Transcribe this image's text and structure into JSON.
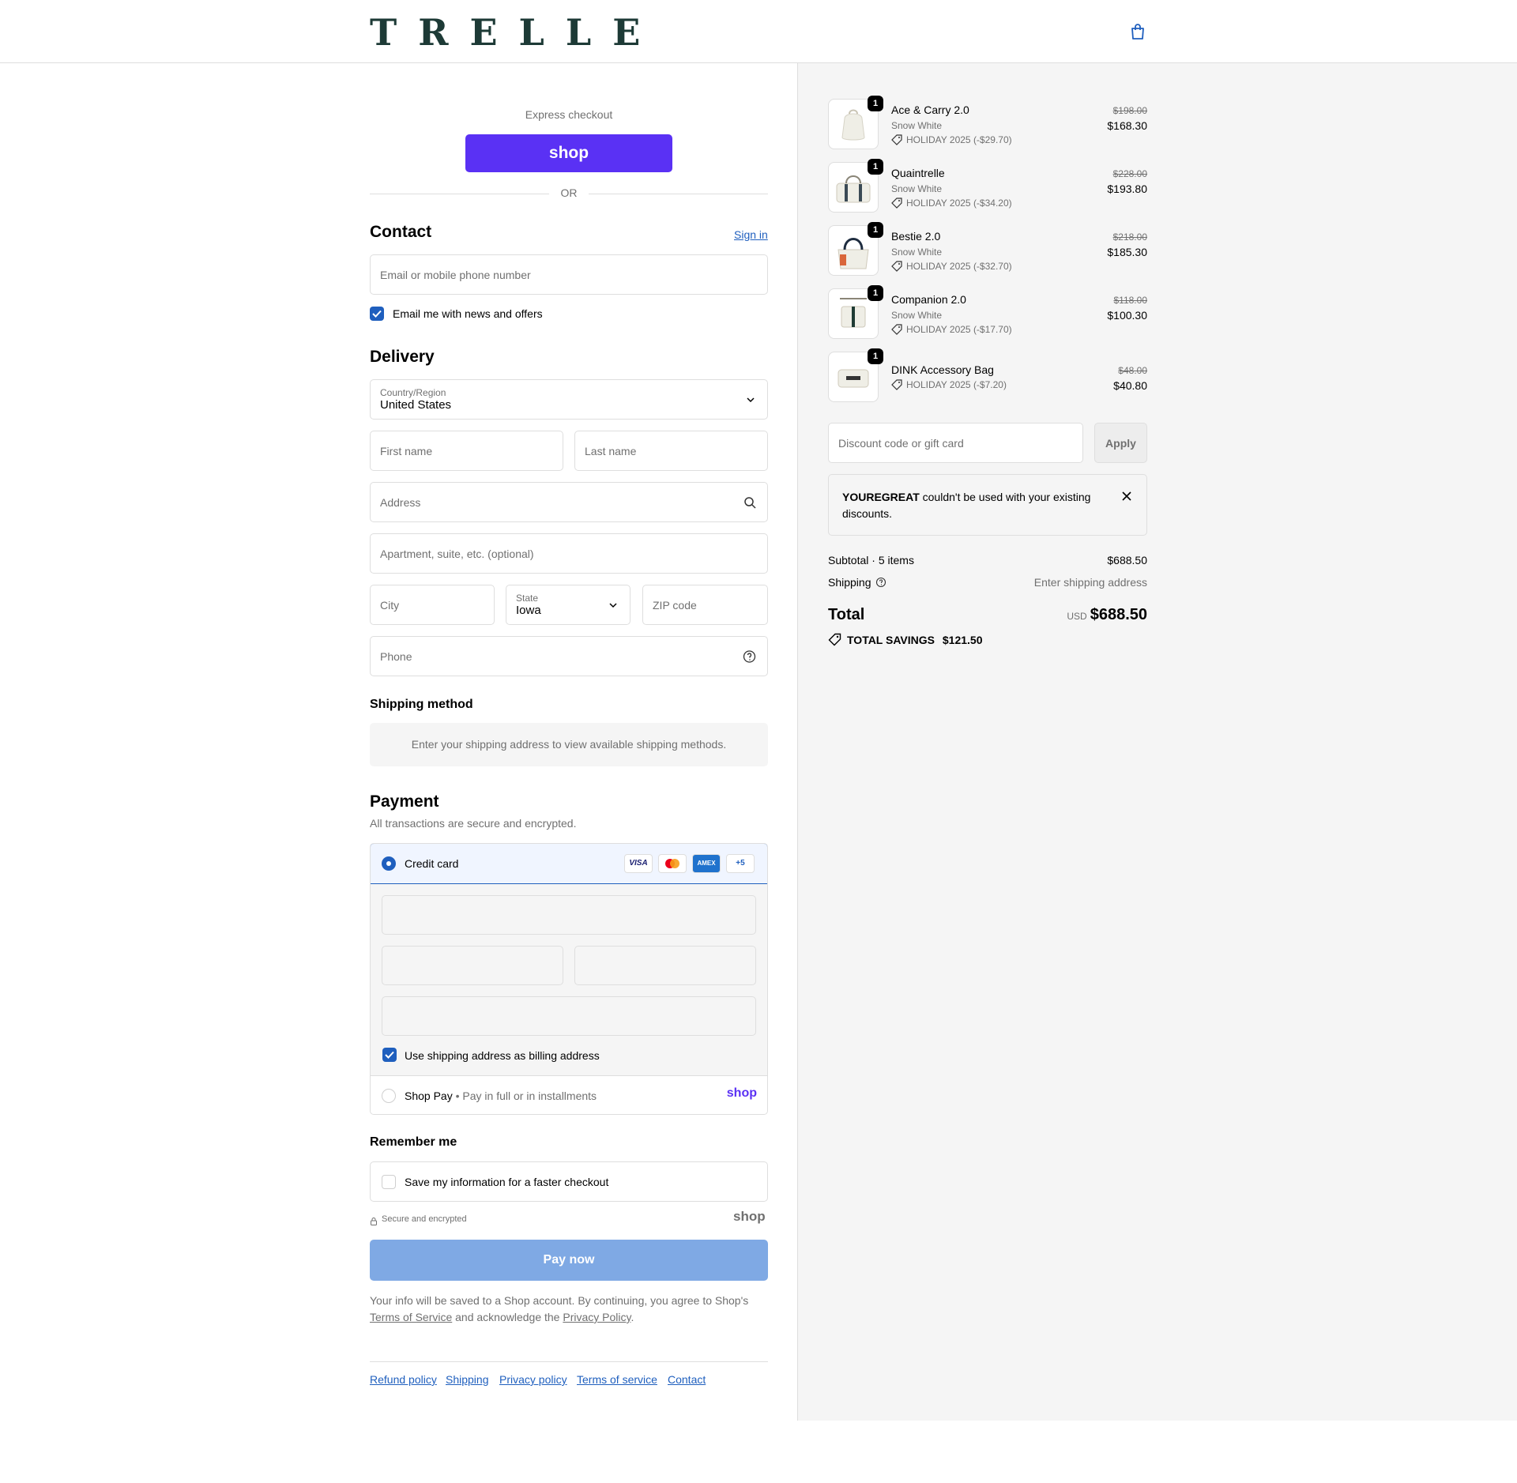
{
  "header": {
    "logo": "TRELLE",
    "cart_icon": "shopping-bag-icon"
  },
  "express": {
    "label": "Express checkout",
    "shop_button": "shop",
    "divider": "OR"
  },
  "contact": {
    "heading": "Contact",
    "sign_in": "Sign in",
    "email_placeholder": "Email or mobile phone number",
    "news_label": "Email me with news and offers",
    "news_checked": true
  },
  "delivery": {
    "heading": "Delivery",
    "country_label": "Country/Region",
    "country_value": "United States",
    "first_name": "First name",
    "last_name": "Last name",
    "address": "Address",
    "apartment": "Apartment, suite, etc. (optional)",
    "city": "City",
    "state_label": "State",
    "state_value": "Iowa",
    "zip": "ZIP code",
    "phone": "Phone"
  },
  "shipping_method": {
    "heading": "Shipping method",
    "message": "Enter your shipping address to view available shipping methods."
  },
  "payment": {
    "heading": "Payment",
    "subtitle": "All transactions are secure and encrypted.",
    "credit_card_label": "Credit card",
    "card_logos": [
      "VISA",
      "",
      "AMEX",
      "+5"
    ],
    "billing_label": "Use shipping address as billing address",
    "shop_pay_label": "Shop Pay",
    "shop_pay_sub": "Pay in full or in installments",
    "shop_pay_logo": "shop"
  },
  "remember": {
    "heading": "Remember me",
    "save_label": "Save my information for a faster checkout",
    "secure_label": "Secure and encrypted",
    "shop_logo": "shop"
  },
  "pay_button": "Pay now",
  "legal": {
    "text1": "Your info will be saved to a Shop account. By continuing, you agree to Shop's",
    "tos": "Terms of Service",
    "text2": "and acknowledge the",
    "privacy": "Privacy Policy",
    "text3": "."
  },
  "footer_links": [
    "Refund policy",
    "Shipping",
    "Privacy policy",
    "Terms of service",
    "Contact"
  ],
  "cart": {
    "items": [
      {
        "name": "Ace & Carry 2.0",
        "variant": "Snow White",
        "discount": "HOLIDAY 2025 (-$29.70)",
        "old_price": "$198.00",
        "price": "$168.30",
        "qty": "1"
      },
      {
        "name": "Quaintrelle",
        "variant": "Snow White",
        "discount": "HOLIDAY 2025 (-$34.20)",
        "old_price": "$228.00",
        "price": "$193.80",
        "qty": "1"
      },
      {
        "name": "Bestie 2.0",
        "variant": "Snow White",
        "discount": "HOLIDAY 2025 (-$32.70)",
        "old_price": "$218.00",
        "price": "$185.30",
        "qty": "1"
      },
      {
        "name": "Companion 2.0",
        "variant": "Snow White",
        "discount": "HOLIDAY 2025 (-$17.70)",
        "old_price": "$118.00",
        "price": "$100.30",
        "qty": "1"
      },
      {
        "name": "DINK Accessory Bag",
        "variant": "",
        "discount": "HOLIDAY 2025 (-$7.20)",
        "old_price": "$48.00",
        "price": "$40.80",
        "qty": "1"
      }
    ],
    "discount_placeholder": "Discount code or gift card",
    "apply": "Apply",
    "notice_code": "YOUREGREAT",
    "notice_text": "couldn't be used with your existing discounts.",
    "subtotal_label": "Subtotal · 5 items",
    "subtotal_value": "$688.50",
    "shipping_label": "Shipping",
    "shipping_value": "Enter shipping address",
    "total_label": "Total",
    "currency": "USD",
    "total_value": "$688.50",
    "savings_label": "TOTAL SAVINGS",
    "savings_value": "$121.50"
  },
  "colors": {
    "brand": "#1d3a36",
    "shop_purple": "#5a31f4",
    "accent_blue": "#1f5fbe",
    "pay_disabled": "#7fa9e4"
  }
}
